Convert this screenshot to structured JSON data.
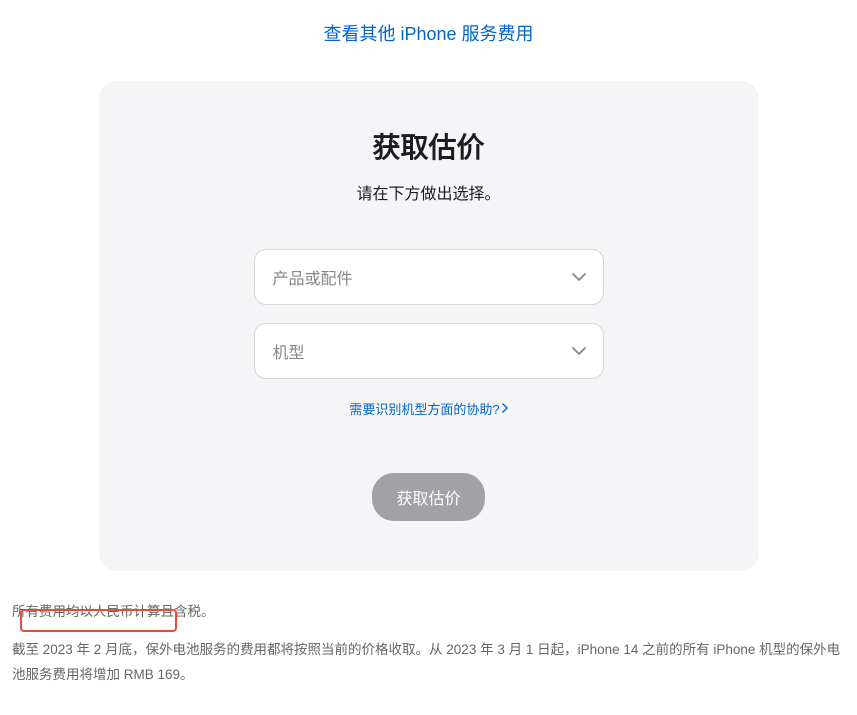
{
  "topLink": {
    "label": "查看其他 iPhone 服务费用"
  },
  "card": {
    "title": "获取估价",
    "subtitle": "请在下方做出选择。",
    "select1": {
      "placeholder": "产品或配件"
    },
    "select2": {
      "placeholder": "机型"
    },
    "helpLink": "需要识别机型方面的协助?",
    "submitLabel": "获取估价"
  },
  "footer": {
    "line1": "所有费用均以人民币计算且含税。",
    "line2": "截至 2023 年 2 月底，保外电池服务的费用都将按照当前的价格收取。从 2023 年 3 月 1 日起，iPhone 14 之前的所有 iPhone 机型的保外电池服务费用将增加 RMB 169。"
  }
}
